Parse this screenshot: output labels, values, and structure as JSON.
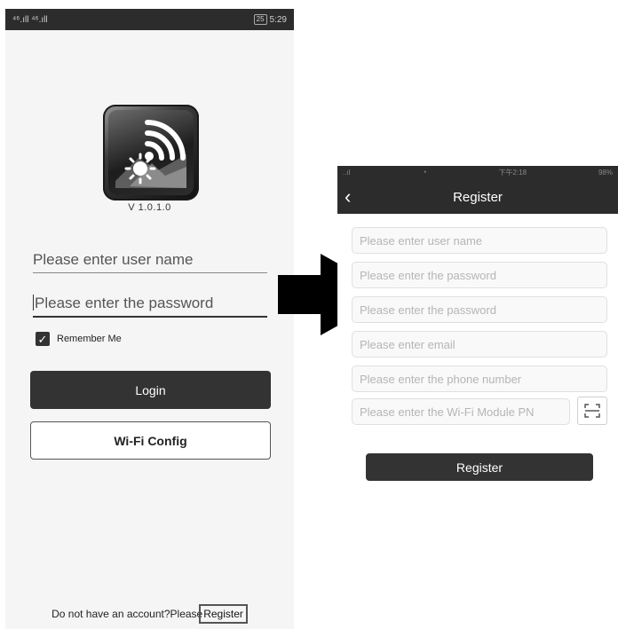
{
  "left": {
    "status": {
      "signal": "⁴⁶.ıll ⁴⁶.ıll",
      "battery": "25",
      "time": "5:29"
    },
    "version": "V 1.0.1.0",
    "username_placeholder": "Please enter user name",
    "password_placeholder": "Please enter the password",
    "remember_label": "Remember Me",
    "login_label": "Login",
    "wifi_config_label": "Wi-Fi Config",
    "footer_prefix": "Do not have an account?Please",
    "register_link": "Register"
  },
  "right": {
    "status": {
      "left": "..ıl",
      "time": "下午2:18",
      "battery": "98%"
    },
    "title": "Register",
    "fields": [
      "Please enter user name",
      "Please enter the password",
      "Please enter the password",
      "Please enter email",
      "Please enter the phone number",
      "Please enter the Wi-Fi Module PN"
    ],
    "register_label": "Register"
  },
  "icons": [
    "checkbox-checked-icon",
    "back-chevron-icon",
    "scan-icon",
    "wifi-sun-logo-icon",
    "arrow-right-icon"
  ],
  "colors": {
    "dark": "#333333",
    "statusbar": "#2c2c2c",
    "placeholder": "#b5b5b5"
  }
}
